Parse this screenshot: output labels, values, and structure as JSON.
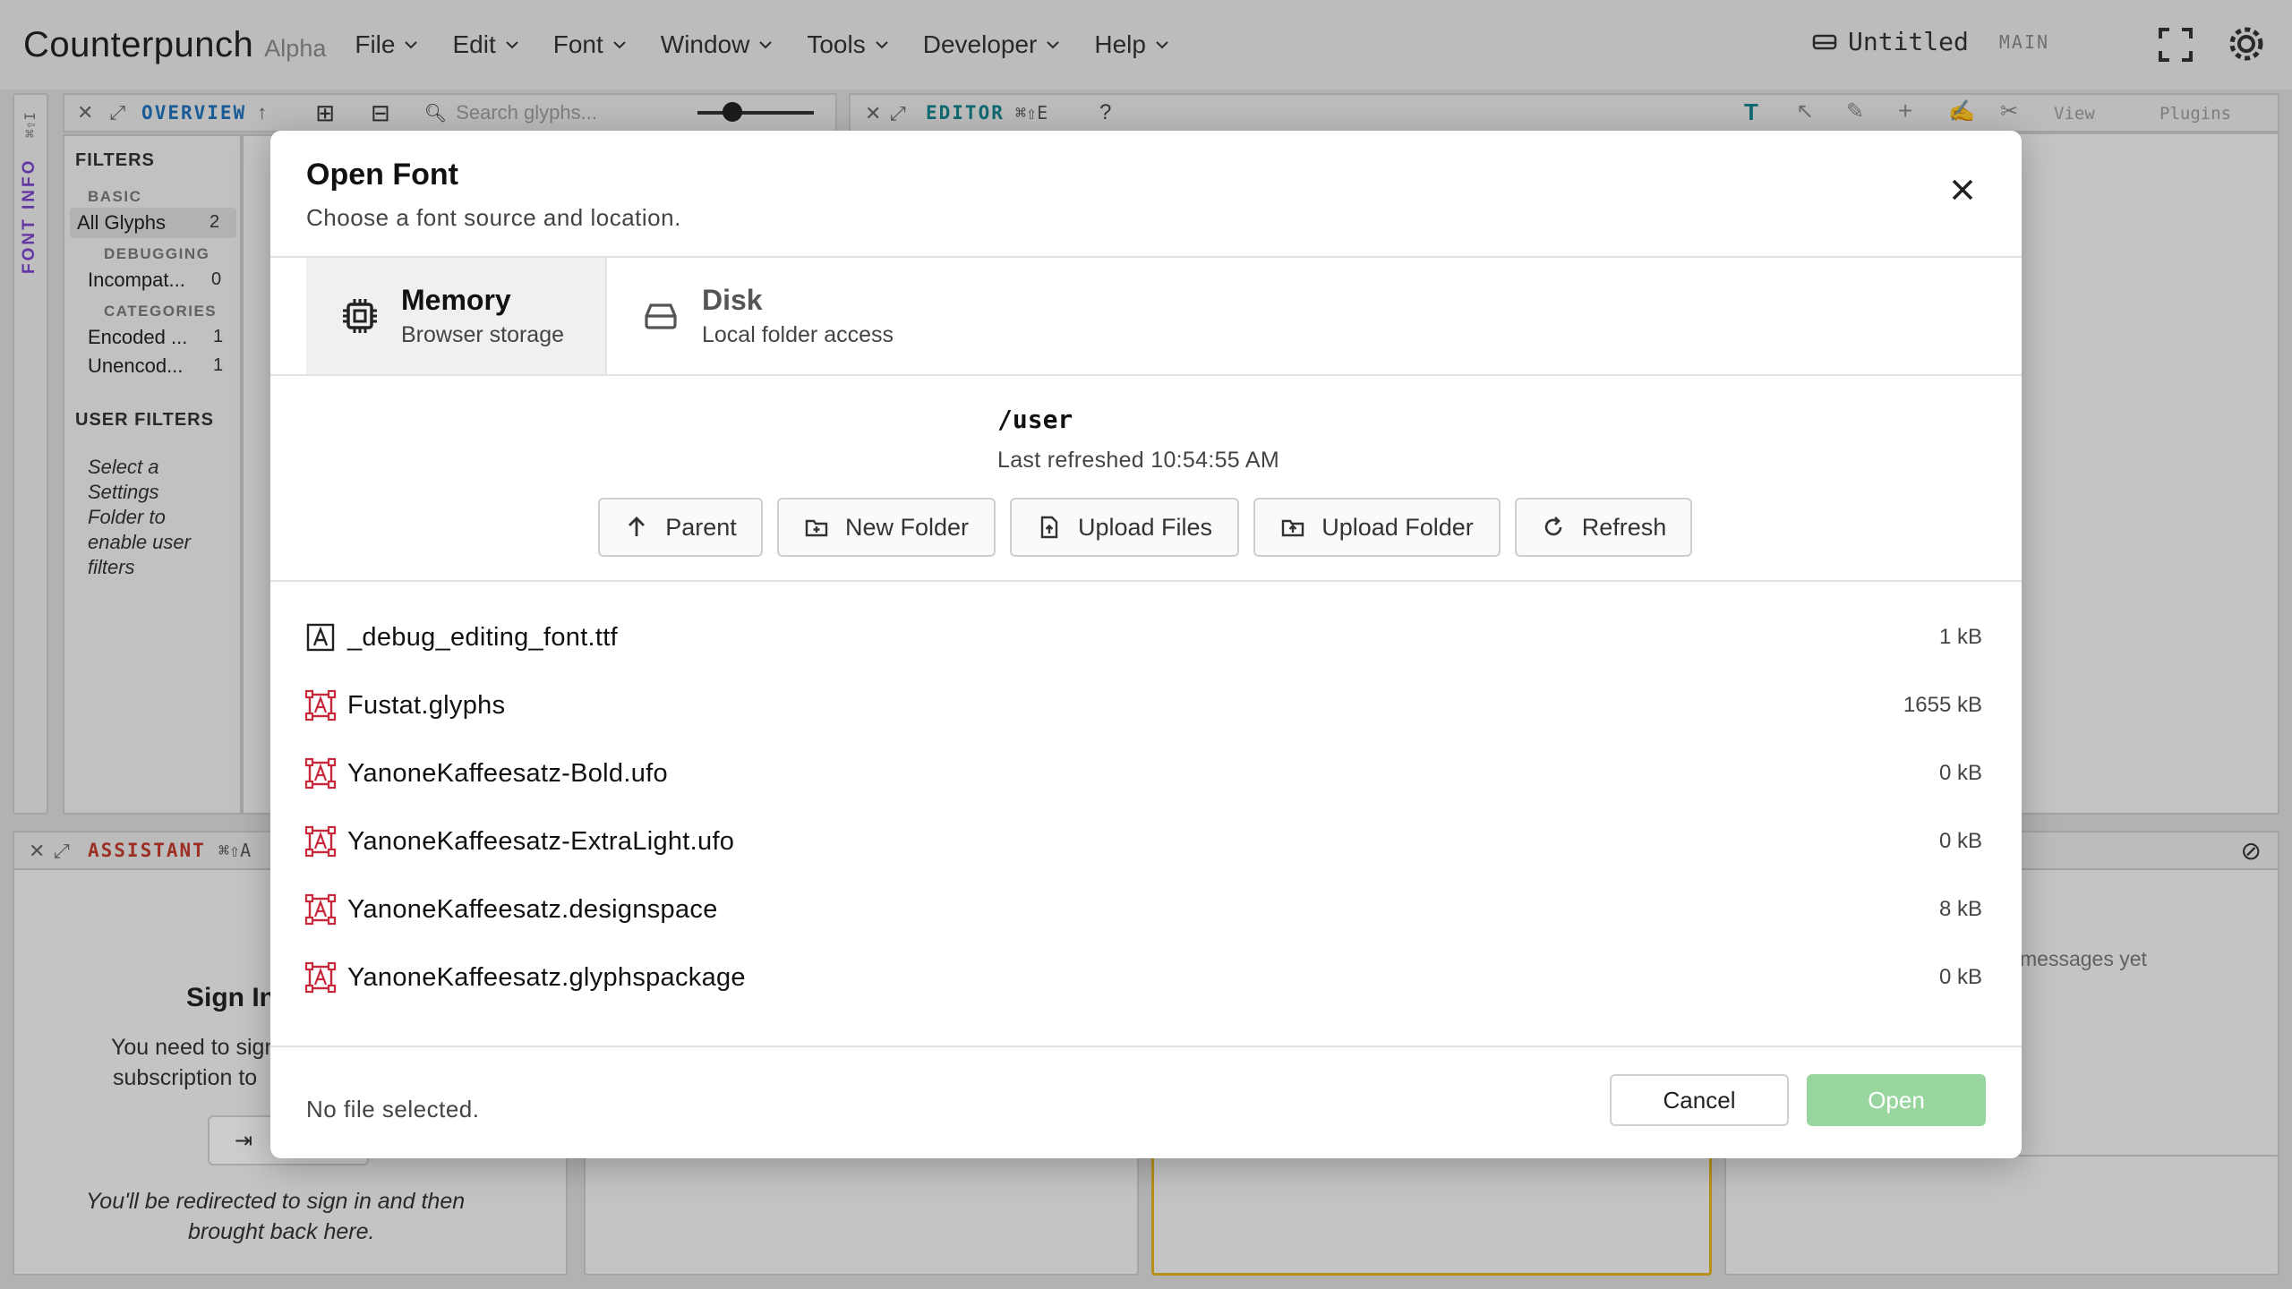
{
  "app": {
    "title": "Counterpunch",
    "badge": "Alpha"
  },
  "menu": [
    {
      "label": "File"
    },
    {
      "label": "Edit"
    },
    {
      "label": "Font"
    },
    {
      "label": "Window"
    },
    {
      "label": "Tools"
    },
    {
      "label": "Developer"
    },
    {
      "label": "Help"
    }
  ],
  "document": {
    "name": "Untitled",
    "branch": "MAIN"
  },
  "sidebar": {
    "vertical_tab": "FONT INFO",
    "shortcut": "⌘⇧I"
  },
  "overview": {
    "title": "OVERVIEW",
    "search_placeholder": "Search glyphs...",
    "filters_title": "FILTERS",
    "basic_label": "BASIC",
    "all_glyphs": "All Glyphs",
    "all_glyphs_count": "2",
    "debugging_label": "DEBUGGING",
    "incompat": "Incompat...",
    "incompat_count": "0",
    "categories_label": "CATEGORIES",
    "encoded": "Encoded ...",
    "encoded_count": "1",
    "unencoded": "Unencod...",
    "unencoded_count": "1",
    "user_filters_title": "USER FILTERS",
    "user_filters_hint": [
      "Select a",
      "Settings",
      "Folder to",
      "enable user",
      "filters"
    ]
  },
  "editor": {
    "title": "EDITOR",
    "shortcut": "⌘⇧E",
    "help": "?",
    "view_menu": "View",
    "plugins_menu": "Plugins"
  },
  "assistant": {
    "title": "ASSISTANT",
    "shortcut": "⌘⇧A",
    "sign_in_title": "Sign In",
    "sign_in_text_1": "You need to sign",
    "sign_in_text_2": "subscription to",
    "redirect_1": "You'll be redirected to sign in and then",
    "redirect_2": "brought back here."
  },
  "messages": {
    "empty": "messages yet"
  },
  "dialog": {
    "title": "Open Font",
    "subtitle": "Choose a font source and location.",
    "tabs": [
      {
        "name": "Memory",
        "desc": "Browser storage"
      },
      {
        "name": "Disk",
        "desc": "Local folder access"
      }
    ],
    "path": "/user",
    "last_refreshed": "Last refreshed 10:54:55 AM",
    "actions": {
      "parent": "Parent",
      "new_folder": "New Folder",
      "upload_files": "Upload Files",
      "upload_folder": "Upload Folder",
      "refresh": "Refresh"
    },
    "files": [
      {
        "name": "_debug_editing_font.ttf",
        "size": "1 kB",
        "icon": "font-file-icon"
      },
      {
        "name": "Fustat.glyphs",
        "size": "1655 kB",
        "icon": "font-source-icon"
      },
      {
        "name": "YanoneKaffeesatz-Bold.ufo",
        "size": "0 kB",
        "icon": "font-source-icon"
      },
      {
        "name": "YanoneKaffeesatz-ExtraLight.ufo",
        "size": "0 kB",
        "icon": "font-source-icon"
      },
      {
        "name": "YanoneKaffeesatz.designspace",
        "size": "8 kB",
        "icon": "font-source-icon"
      },
      {
        "name": "YanoneKaffeesatz.glyphspackage",
        "size": "0 kB",
        "icon": "font-source-icon"
      }
    ],
    "status": "No file selected.",
    "cancel": "Cancel",
    "open": "Open"
  },
  "colors": {
    "accent_blue": "#1f6fb8",
    "accent_teal": "#14808c",
    "assistant_red": "#c0392b",
    "font_icon_red": "#c8293a",
    "open_disabled": "#99d69f",
    "vertical_tab_purple": "#7a43c8"
  }
}
